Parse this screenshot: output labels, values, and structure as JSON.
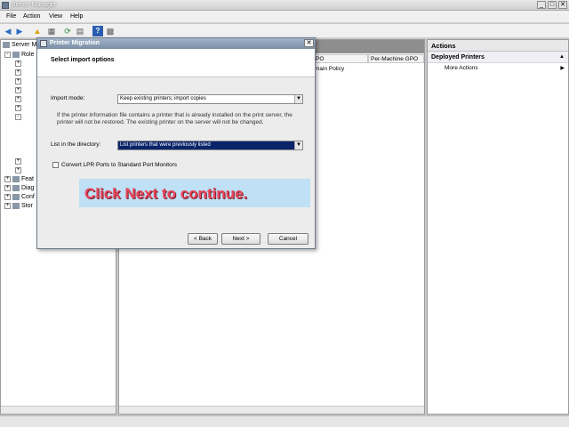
{
  "window": {
    "title": "Server Manager",
    "minimize": "_",
    "maximize": "□",
    "close": "✕"
  },
  "menu": {
    "file": "File",
    "action": "Action",
    "view": "View",
    "help": "Help"
  },
  "tree": {
    "root": "Server M",
    "roles": "Role",
    "features": "Feat",
    "diagnostics": "Diag",
    "configuration": "Conf",
    "storage": "Stor"
  },
  "center": {
    "col_gpo": "PO",
    "col_per_machine": "Per-Machine GPO",
    "policy_text": "main Policy"
  },
  "actions": {
    "header": "Actions",
    "section": "Deployed Printers",
    "more_actions": "More Actions"
  },
  "dialog": {
    "title": "Printer Migration",
    "heading": "Select import options",
    "import_mode_label": "Import mode:",
    "import_mode_value": "Keep existing printers; import copies",
    "info_text": "If the printer information file contains a printer that is already installed on the print server, the printer will not be restored. The existing printer on the server will not be changed.",
    "list_label": "List in the directory:",
    "list_value": "List printers that were previously listed",
    "convert_lpr_label": "Convert LPR Ports to Standard Port Monitors",
    "convert_lpr_checked": false,
    "back_button": "< Back",
    "next_button": "Next >",
    "cancel_button": "Cancel",
    "close": "✕"
  },
  "callout": {
    "text": "Click Next to continue."
  },
  "colors": {
    "callout_bg": "#bfe0f5",
    "callout_text": "#e8455a",
    "selection": "#0a246a"
  }
}
